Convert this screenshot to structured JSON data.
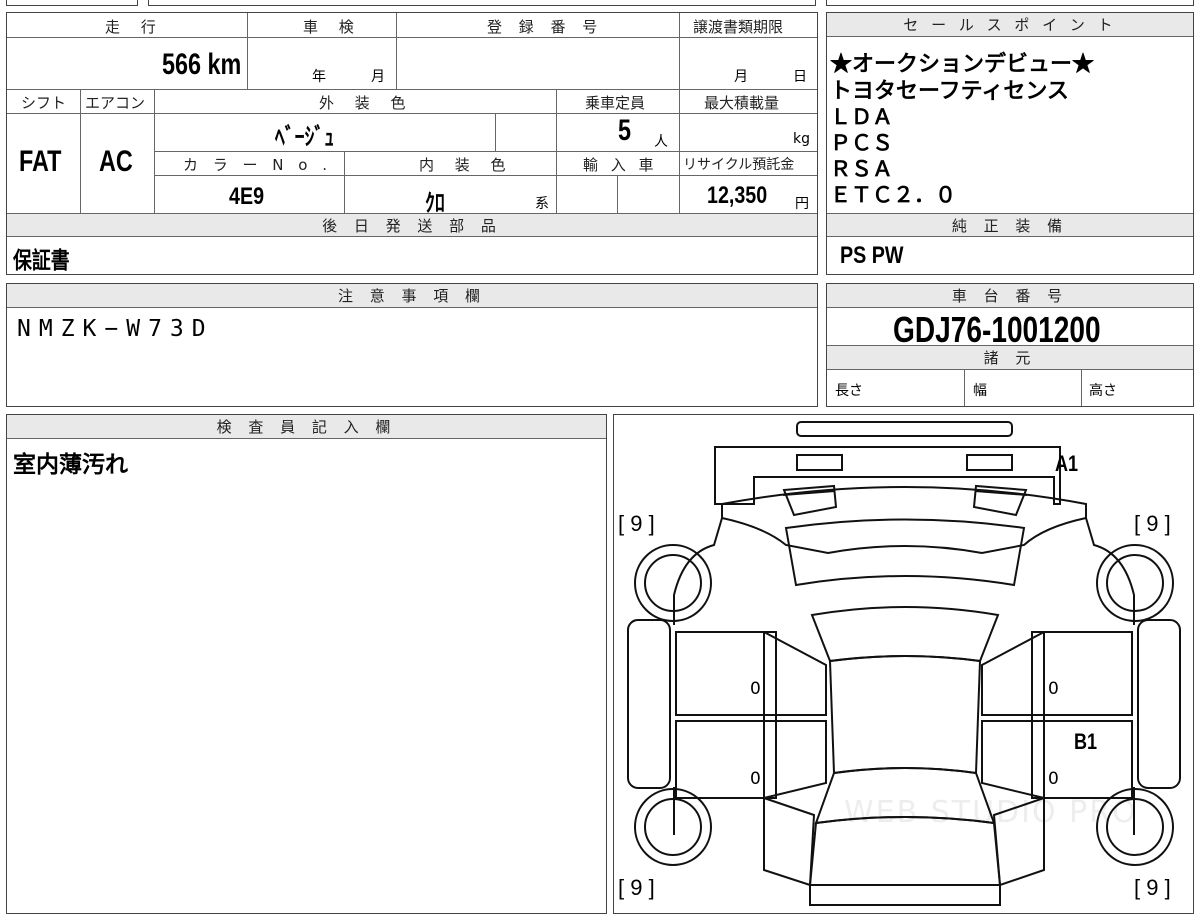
{
  "headers": {
    "mileage": "走 行",
    "shaken": "車 検",
    "registration": "登 録 番 号",
    "transfer_deadline": "譲渡書類期限",
    "sales_points": "セ ー ル ス ポ イ ン ト",
    "shift": "シフト",
    "aircon": "エアコン",
    "exterior_color": "外 装 色",
    "capacity": "乗車定員",
    "max_load": "最大積載量",
    "color_no": "カ ラ ー N o .",
    "interior_color": "内 装 色",
    "import": "輸 入 車",
    "recycle_fee": "リサイクル預託金",
    "later_parts": "後 日 発 送 部 品",
    "genuine_equipment": "純 正 装 備",
    "notes": "注 意 事 項 欄",
    "chassis_no": "車 台 番 号",
    "specs": "諸 元",
    "inspector": "検 査 員 記 入 欄"
  },
  "values": {
    "mileage": "566 km",
    "shaken_year": "年",
    "shaken_month": "月",
    "transfer_month": "月",
    "transfer_day": "日",
    "shift": "FAT",
    "aircon": "AC",
    "exterior_color": "ﾍﾞｰｼﾞｭ",
    "capacity": "5",
    "capacity_unit": "人",
    "max_load_unit": "kg",
    "color_no": "4E9",
    "interior_color": "ｸﾛ",
    "interior_suffix": "系",
    "recycle_fee": "12,350",
    "recycle_unit": "円",
    "later_parts": "保証書",
    "genuine_equipment": "PS PW",
    "notes": "NMZK−W73D",
    "chassis_no": "GDJ76-1001200",
    "spec_length": "長さ",
    "spec_width": "幅",
    "spec_height": "高さ",
    "inspector": "室内薄汚れ"
  },
  "sales_points": [
    "★オークションデビュー★",
    "トヨタセーフティセンス",
    "ＬＤＡ",
    "ＰＣＳ",
    "ＲＳＡ",
    "ＥＴＣ２．０"
  ],
  "diagram": {
    "marks": [
      "A1",
      "B1"
    ],
    "corner_label": "[ 9 ]",
    "door_values": [
      "0",
      "0",
      "0",
      "0"
    ],
    "watermark": "WEB STUDIO PRO"
  }
}
